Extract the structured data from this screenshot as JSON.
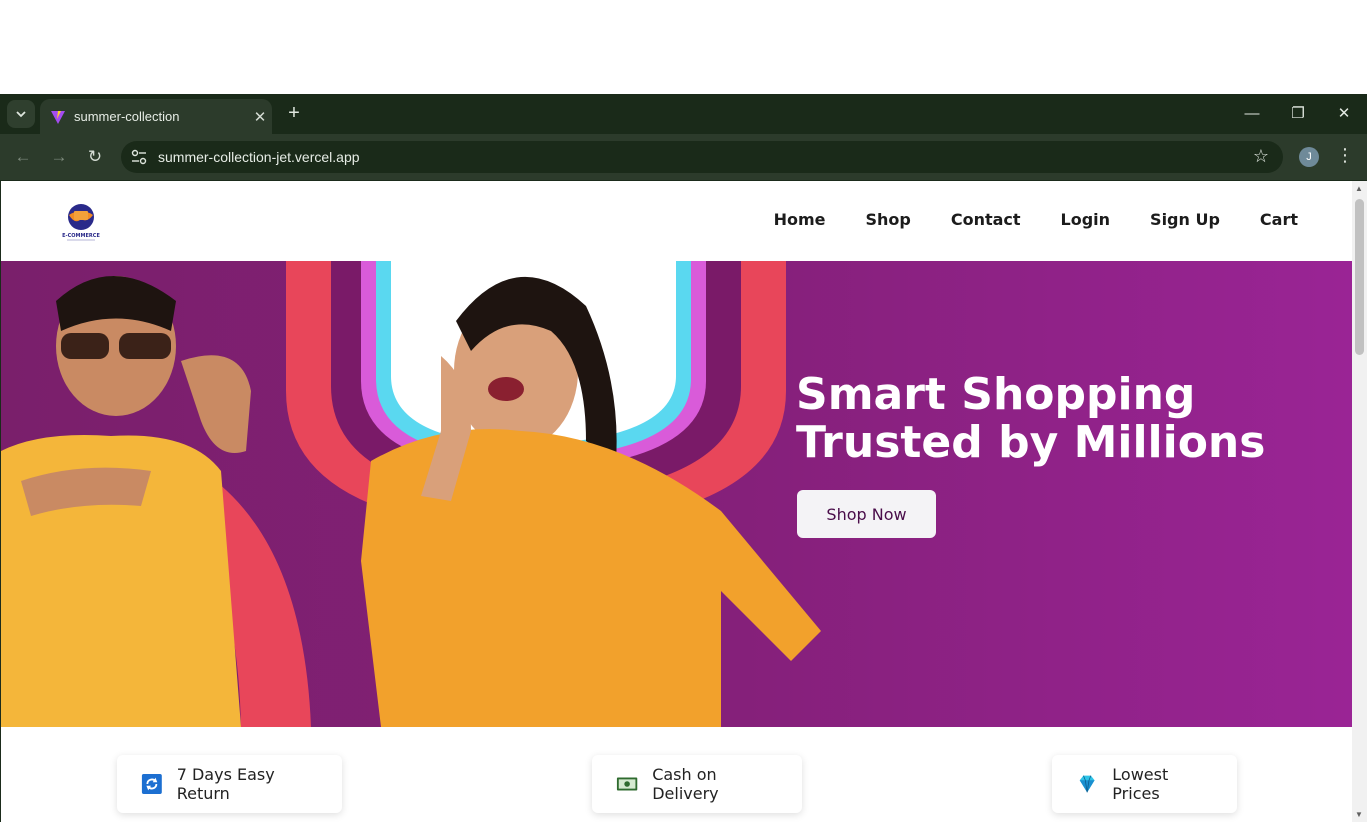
{
  "browser": {
    "tab_title": "summer-collection",
    "url": "summer-collection-jet.vercel.app",
    "profile_initial": "J"
  },
  "site": {
    "logo_text": "E-COMMERCE",
    "nav": [
      "Home",
      "Shop",
      "Contact",
      "Login",
      "Sign Up",
      "Cart"
    ],
    "hero": {
      "title_line1": "Smart Shopping",
      "title_line2": "Trusted by Millions",
      "cta": "Shop Now"
    },
    "features": [
      {
        "label": "7 Days Easy Return",
        "icon": "return-icon"
      },
      {
        "label": "Cash on Delivery",
        "icon": "cash-icon"
      },
      {
        "label": "Lowest Prices",
        "icon": "diamond-icon"
      }
    ]
  },
  "colors": {
    "hero_purple": "#85207a",
    "browser_frame": "#1a2a19",
    "cta_text": "#4a0d4a"
  }
}
